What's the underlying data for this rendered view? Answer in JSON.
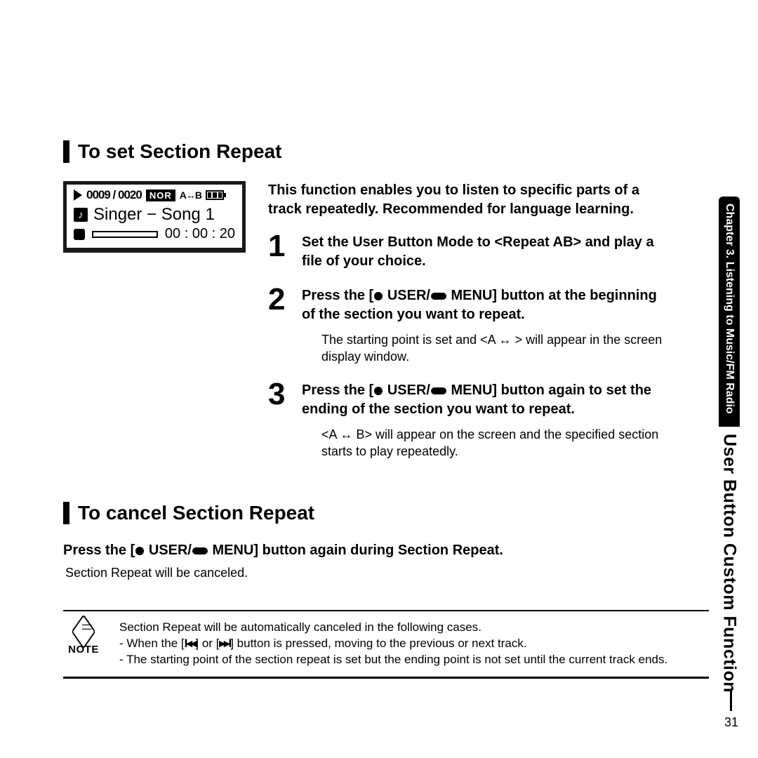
{
  "side": {
    "chapter": "Chapter 3.  Listening to Music/FM Radio",
    "feature": "User Button Custom Function"
  },
  "page_number": "31",
  "section1_title": "To set Section Repeat",
  "lcd": {
    "counter": "0009 / 0020",
    "nor": "NOR",
    "ab": "A↔B",
    "song": "Singer − Song 1",
    "time": "00 : 00 : 20"
  },
  "intro": "This function enables you to listen to specific parts of a track repeatedly. Recommended for language learning.",
  "steps": [
    {
      "n": "1",
      "main": "Set the User Button Mode to <Repeat AB> and play a file of your choice."
    },
    {
      "n": "2",
      "main_pre": "Press the [",
      "main_mid": " USER/",
      "main_post": " MENU] button at the beginning of the section you want to repeat.",
      "sub": "The starting point is set and <A ↔ > will appear in the screen display window."
    },
    {
      "n": "3",
      "main_pre": "Press the [",
      "main_mid": " USER/",
      "main_post": " MENU] button again to set the ending of the section you want to repeat.",
      "sub": "<A ↔ B> will appear on the screen and the specified section starts to play repeatedly."
    }
  ],
  "section2_title": "To cancel Section Repeat",
  "cancel_main_pre": "Press the [",
  "cancel_main_mid": " USER/",
  "cancel_main_post": " MENU] button again during Section Repeat.",
  "cancel_sub": "Section Repeat will be canceled.",
  "note_label": "NOTE",
  "note_line1": "Section Repeat will be automatically canceled in the following cases.",
  "note_line2_pre": "- When the [",
  "note_line2_a": "I◂◂",
  "note_line2_mid": "] or [",
  "note_line2_b": "▸▸I",
  "note_line2_post": "] button is pressed, moving to the previous or next track.",
  "note_line3": "- The starting point of the section repeat is set but the ending point is not set until the current track ends."
}
